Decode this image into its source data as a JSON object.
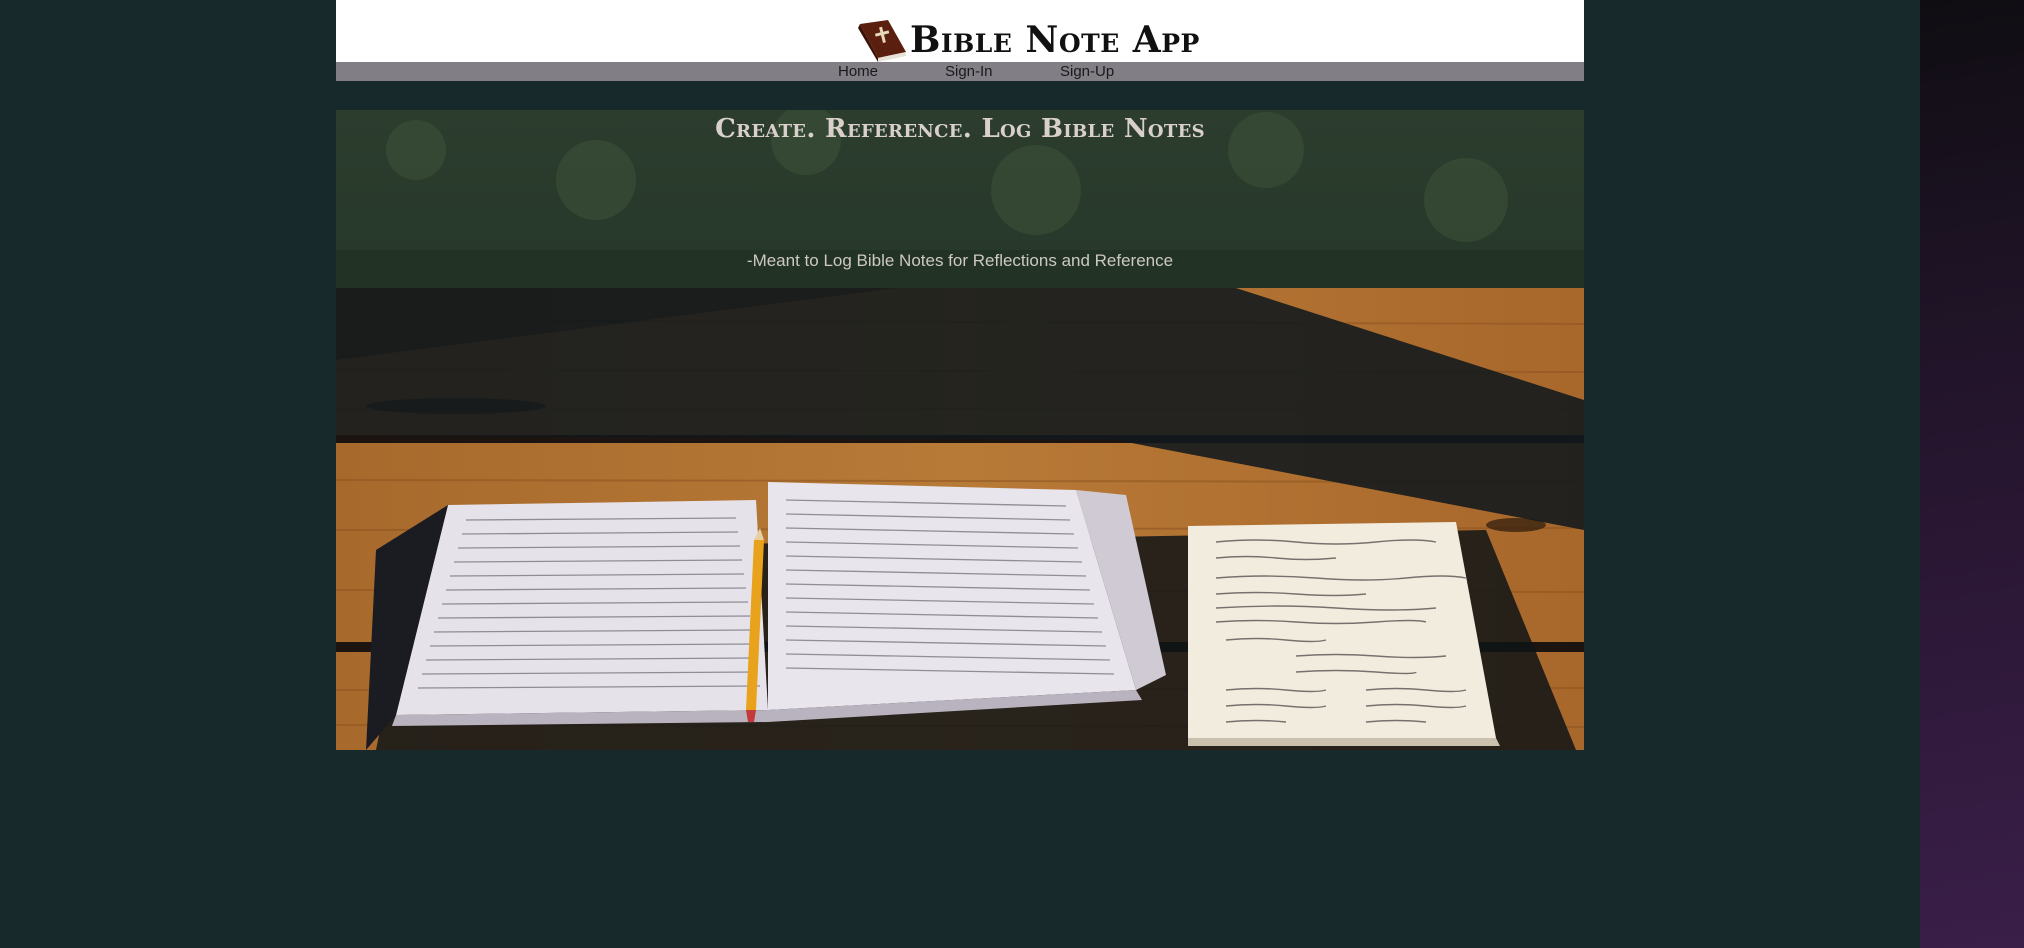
{
  "header": {
    "title": "Bible Note App",
    "logo_icon": "bible-book-icon"
  },
  "nav": {
    "items": [
      {
        "label": "Home"
      },
      {
        "label": "Sign-In"
      },
      {
        "label": "Sign-Up"
      }
    ]
  },
  "hero": {
    "title": "Create. Reference. Log Bible Notes",
    "subtitle": "-Meant to Log Bible Notes for Reflections and Reference",
    "image": "open-bible-and-notebook-on-wooden-table"
  },
  "colors": {
    "background": "#18292b",
    "header_bg": "#ffffff",
    "nav_bg": "#827e85",
    "book_brown": "#5a1f0e"
  }
}
